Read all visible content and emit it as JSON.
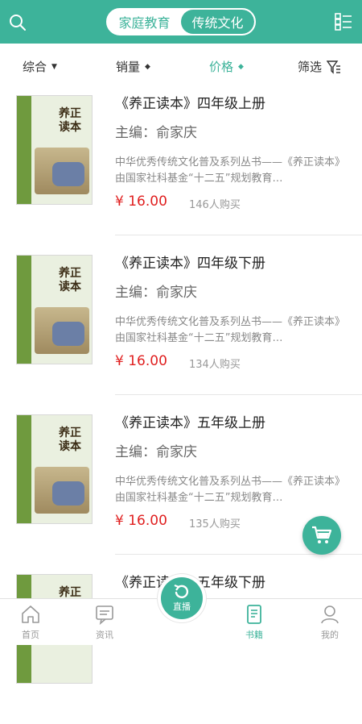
{
  "header": {
    "segments": [
      "家庭教育",
      "传统文化"
    ],
    "active_segment": 1
  },
  "sort": {
    "items": [
      {
        "label": "综合",
        "arrow": "▼"
      },
      {
        "label": "销量",
        "arrow": "◆"
      },
      {
        "label": "价格",
        "arrow": "◆"
      },
      {
        "label": "筛选",
        "arrow": ""
      }
    ],
    "active_index": 2
  },
  "books": [
    {
      "name": "《养正读本》四年级上册",
      "author": "主编：俞家庆",
      "desc": "中华优秀传统文化普及系列丛书——《养正读本》由国家社科基金“十二五”规划教育…",
      "price": "¥ 16.00",
      "sold": "146人购买",
      "cover_title": "养正读本"
    },
    {
      "name": "《养正读本》四年级下册",
      "author": "主编：俞家庆",
      "desc": "中华优秀传统文化普及系列丛书——《养正读本》由国家社科基金“十二五”规划教育…",
      "price": "¥ 16.00",
      "sold": "134人购买",
      "cover_title": "养正读本"
    },
    {
      "name": "《养正读本》五年级上册",
      "author": "主编：俞家庆",
      "desc": "中华优秀传统文化普及系列丛书——《养正读本》由国家社科基金“十二五”规划教育…",
      "price": "¥ 16.00",
      "sold": "135人购买",
      "cover_title": "养正读本"
    },
    {
      "name": "《养正读本》五年级下册",
      "author": "",
      "desc": "",
      "price": "",
      "sold": "",
      "cover_title": "养正"
    }
  ],
  "tabbar": {
    "tabs": [
      {
        "label": "首页",
        "icon": "home-icon"
      },
      {
        "label": "资讯",
        "icon": "news-icon"
      },
      {
        "label": "书籍",
        "icon": "book-icon"
      },
      {
        "label": "我的",
        "icon": "profile-icon"
      }
    ],
    "active_index": 2,
    "live_label": "直播"
  },
  "colors": {
    "accent": "#3db39a",
    "price": "#e02020"
  }
}
